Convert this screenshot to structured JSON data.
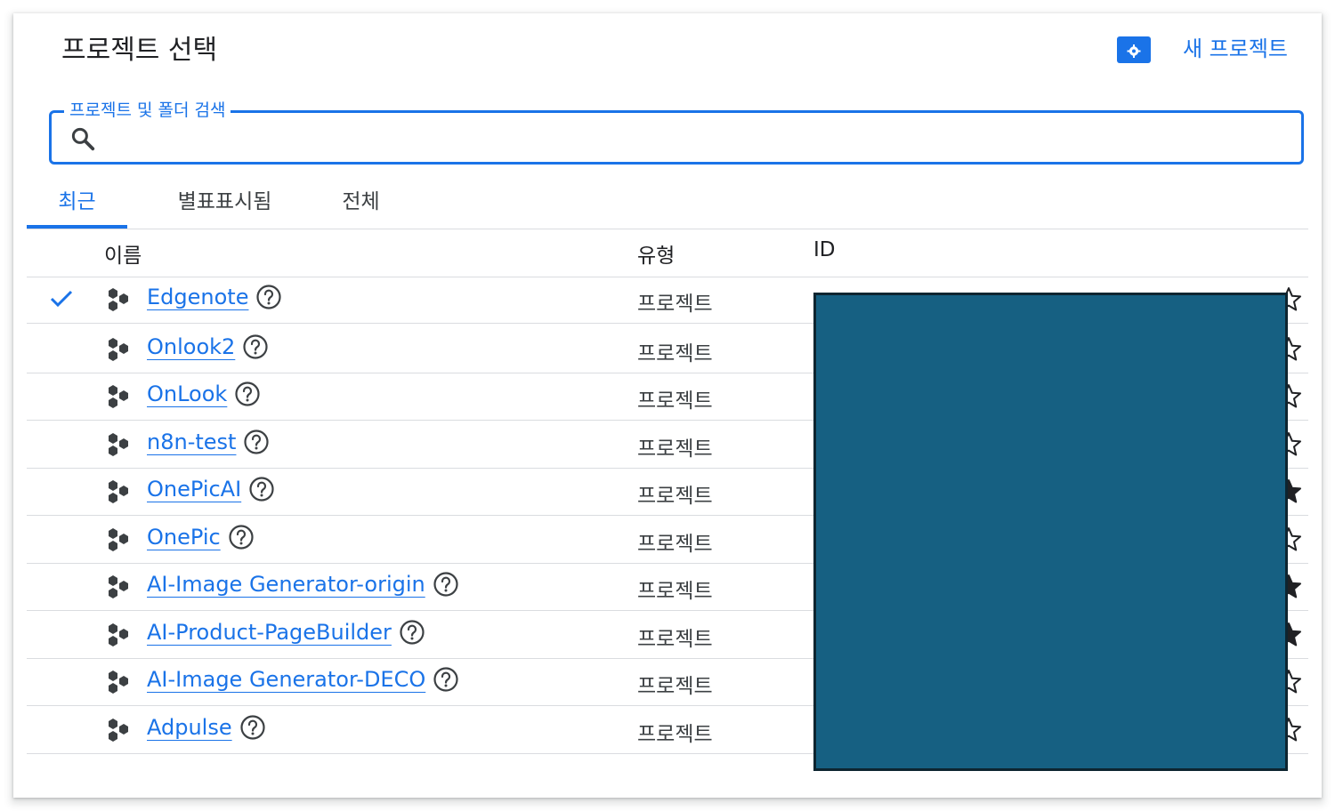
{
  "header": {
    "title": "프로젝트 선택",
    "settings_icon": "folder-gear-icon",
    "new_project_label": "새 프로젝트"
  },
  "search": {
    "label": "프로젝트 및 폴더 검색",
    "value": "",
    "placeholder": ""
  },
  "tabs": [
    {
      "label": "최근",
      "active": true
    },
    {
      "label": "별표표시됨",
      "active": false
    },
    {
      "label": "전체",
      "active": false
    }
  ],
  "table": {
    "columns": [
      "이름",
      "유형",
      "ID"
    ],
    "rows": [
      {
        "name": "Edgenote",
        "type": "프로젝트",
        "selected": true,
        "starred": false
      },
      {
        "name": "Onlook2",
        "type": "프로젝트",
        "selected": false,
        "starred": false
      },
      {
        "name": "OnLook",
        "type": "프로젝트",
        "selected": false,
        "starred": false
      },
      {
        "name": "n8n-test",
        "type": "프로젝트",
        "selected": false,
        "starred": false
      },
      {
        "name": "OnePicAI",
        "type": "프로젝트",
        "selected": false,
        "starred": true
      },
      {
        "name": "OnePic",
        "type": "프로젝트",
        "selected": false,
        "starred": false
      },
      {
        "name": "AI-Image Generator-origin",
        "type": "프로젝트",
        "selected": false,
        "starred": true
      },
      {
        "name": "AI-Product-PageBuilder",
        "type": "프로젝트",
        "selected": false,
        "starred": true
      },
      {
        "name": "AI-Image Generator-DECO",
        "type": "프로젝트",
        "selected": false,
        "starred": false
      },
      {
        "name": "Adpulse",
        "type": "프로젝트",
        "selected": false,
        "starred": false
      }
    ]
  },
  "colors": {
    "accent": "#1a73e8",
    "redaction": "#166082",
    "divider": "#dadce0"
  }
}
